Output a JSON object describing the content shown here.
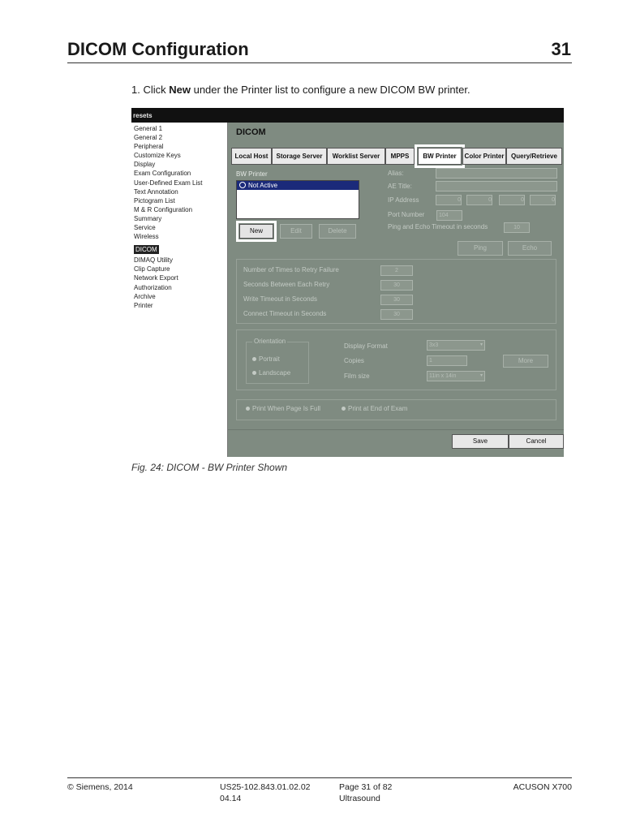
{
  "header": {
    "title": "DICOM Configuration",
    "page_number": "31"
  },
  "step": {
    "number": "1.",
    "pre": "Click ",
    "bold": "New",
    "post": " under the Printer list to configure a new DICOM BW printer."
  },
  "screenshot": {
    "topbar_label": "resets",
    "sidebar_items": [
      "General 1",
      "General 2",
      "Peripheral",
      "Customize Keys",
      "Display",
      "Exam Configuration",
      "User-Defined Exam List",
      "Text Annotation",
      "Pictogram List",
      "M & R Configuration",
      "Summary",
      "Service",
      "Wireless",
      "DICOM",
      "DIMAQ Utility",
      "Clip Capture",
      "Network Export",
      "Authorization",
      "Archive",
      "Printer"
    ],
    "selected_sidebar_item": "DICOM",
    "panel_title": "DICOM",
    "tabs": [
      "Local Host",
      "Storage Server",
      "Worklist Server",
      "MPPS",
      "BW Printer",
      "Color Printer",
      "Query/Retrieve"
    ],
    "active_tab": "BW Printer",
    "printer_list_label": "BW Printer",
    "printer_list_item": "Not Active",
    "buttons": {
      "new": "New",
      "edit": "Edit",
      "delete": "Delete",
      "ping": "Ping",
      "echo": "Echo",
      "save": "Save",
      "cancel": "Cancel",
      "more": "More"
    },
    "fields": {
      "alias": "Alias:",
      "ae_title": "AE Title:",
      "ip_address": "IP Address",
      "ip_octets": [
        "0",
        "0",
        "0",
        "0"
      ],
      "port_number": "Port Number",
      "port_value": "104",
      "ping_timeout": "Ping and Echo Timeout in seconds",
      "ping_timeout_value": "10"
    },
    "retry": {
      "times_label": "Number of Times to Retry Failure",
      "times_value": "2",
      "seconds_label": "Seconds Between Each Retry",
      "seconds_value": "30",
      "write_label": "Write Timeout in Seconds",
      "write_value": "30",
      "connect_label": "Connect Timeout in Seconds",
      "connect_value": "30"
    },
    "print": {
      "orientation_label": "Orientation",
      "portrait": "Portrait",
      "landscape": "Landscape",
      "display_format_label": "Display Format",
      "display_format_value": "3x3",
      "copies_label": "Copies",
      "copies_value": "1",
      "film_size_label": "Film size",
      "film_size_value": "11in x 14in",
      "print_when_full": "Print When Page Is Full",
      "print_end_exam": "Print at End of Exam"
    }
  },
  "caption": "Fig. 24:    DICOM - BW Printer Shown",
  "footer": {
    "copyright": "© Siemens, 2014",
    "doc_number": "US25-102.843.01.02.02",
    "doc_date": "04.14",
    "page": "Page 31 of 82",
    "category": "Ultrasound",
    "product": "ACUSON X700"
  }
}
